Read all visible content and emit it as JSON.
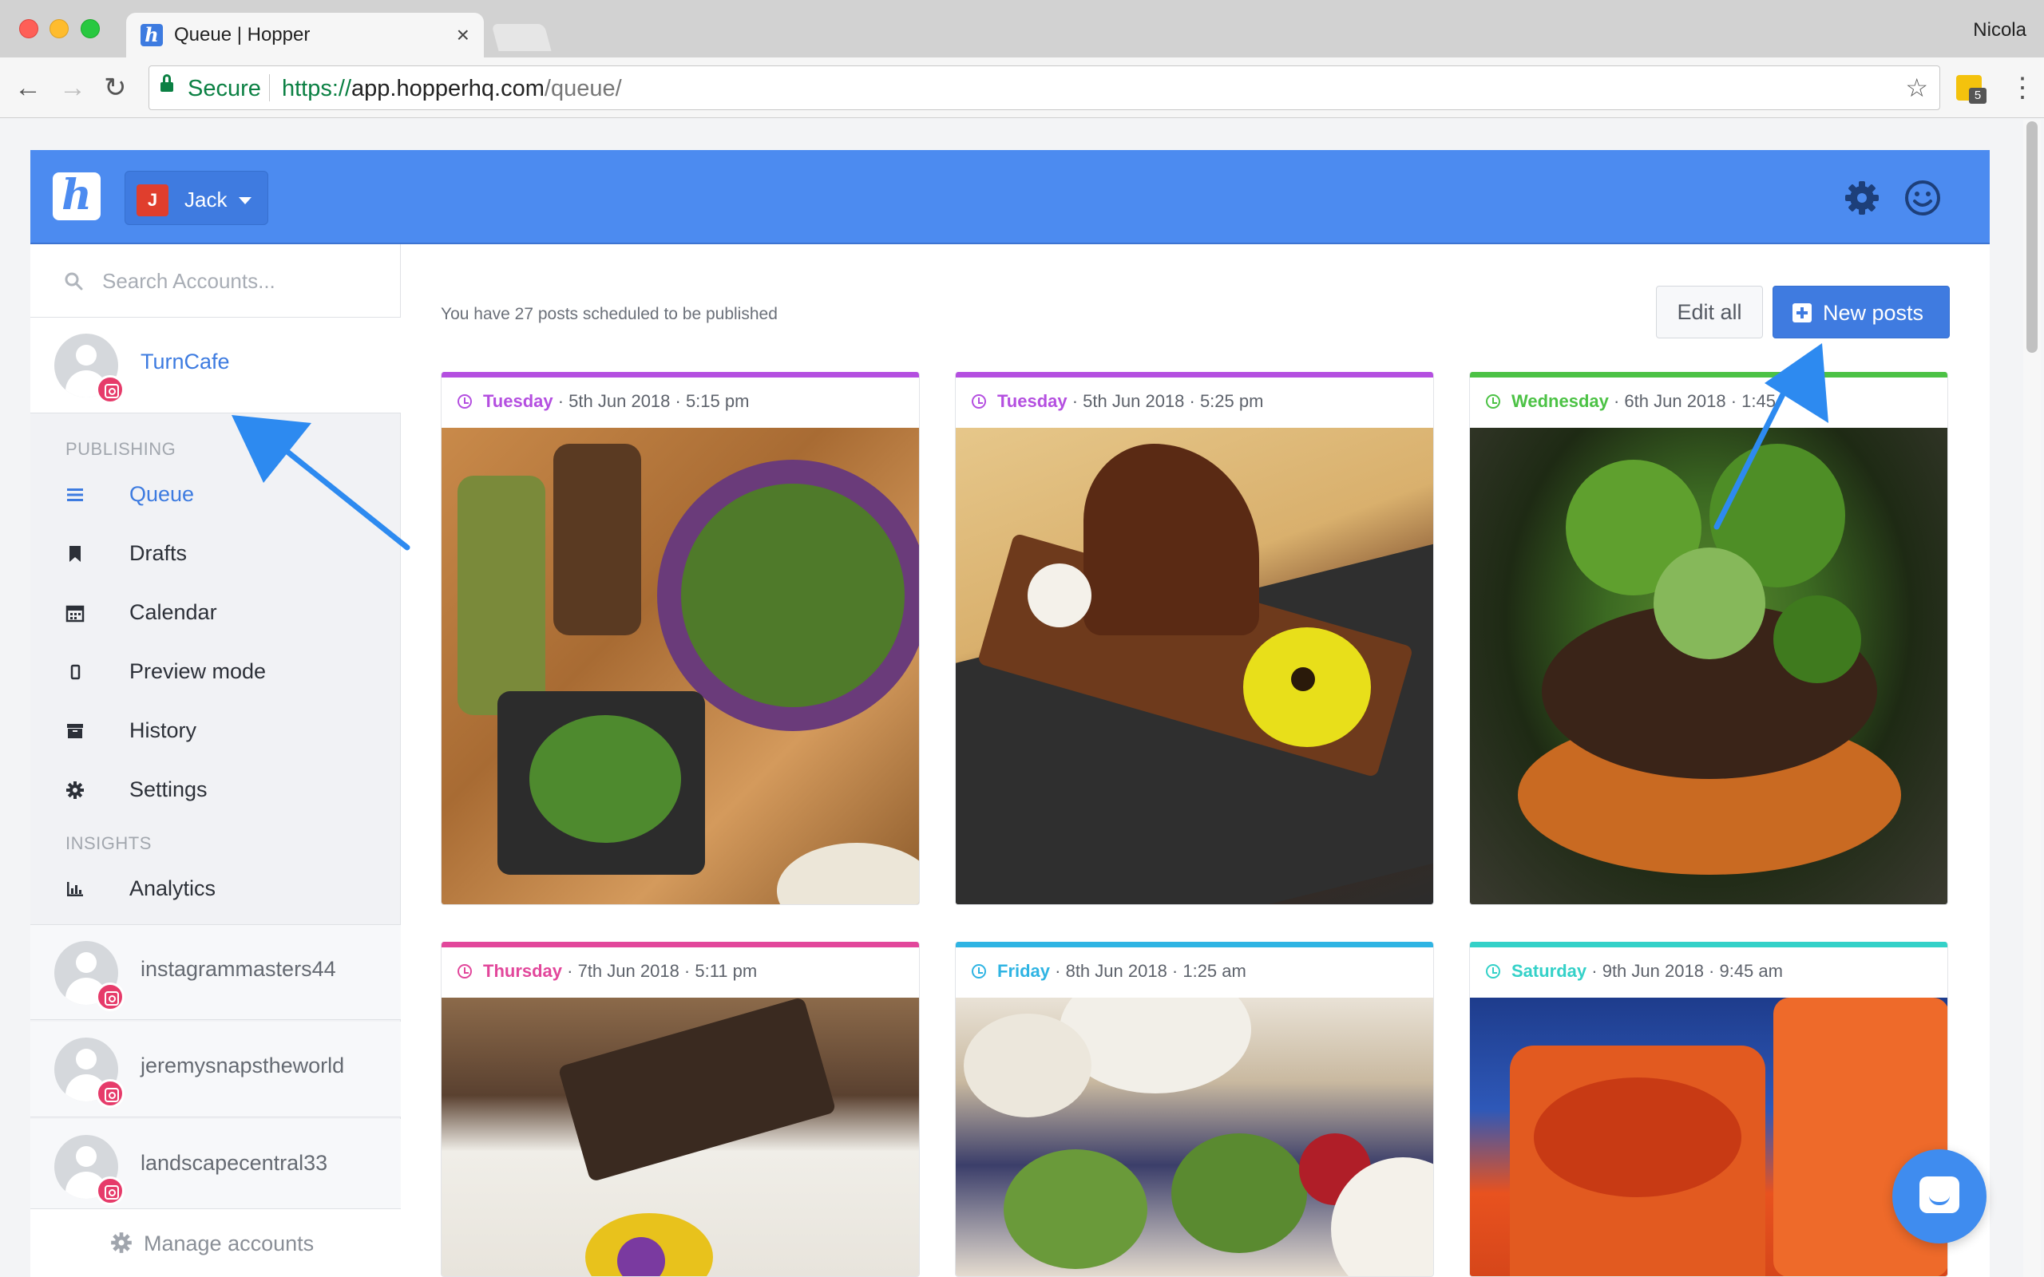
{
  "browser": {
    "tab_title": "Queue | Hopper",
    "profile_name": "Nicola",
    "secure_label": "Secure",
    "url_protocol": "https://",
    "url_host": "app.hopperhq.com",
    "url_path": "/queue/",
    "extension_badge": "5"
  },
  "header": {
    "logo_letter": "h",
    "account_initial": "J",
    "account_name": "Jack"
  },
  "sidebar": {
    "search_placeholder": "Search Accounts...",
    "active_account": "TurnCafe",
    "sections": {
      "publishing": "PUBLISHING",
      "insights": "INSIGHTS"
    },
    "items": [
      {
        "label": "Queue",
        "icon": "list-icon"
      },
      {
        "label": "Drafts",
        "icon": "bookmark-icon"
      },
      {
        "label": "Calendar",
        "icon": "calendar-icon"
      },
      {
        "label": "Preview mode",
        "icon": "phone-icon"
      },
      {
        "label": "History",
        "icon": "archive-icon"
      },
      {
        "label": "Settings",
        "icon": "gear-icon"
      }
    ],
    "analytics": {
      "label": "Analytics",
      "icon": "bar-chart-icon"
    },
    "other_accounts": [
      "instagrammasters44",
      "jeremysnapstheworld",
      "landscapecentral33"
    ],
    "manage_label": "Manage accounts"
  },
  "main": {
    "scheduled_text": "You have 27 posts scheduled to be published",
    "edit_all_label": "Edit all",
    "new_posts_label": "New posts"
  },
  "posts": [
    {
      "day": "Tuesday",
      "details": " · 5th Jun 2018 · 5:15 pm",
      "color": "#b44fe0"
    },
    {
      "day": "Tuesday",
      "details": " · 5th Jun 2018 · 5:25 pm",
      "color": "#b44fe0"
    },
    {
      "day": "Wednesday",
      "details": " · 6th Jun 2018 · 1:45",
      "color": "#4cc245"
    },
    {
      "day": "Thursday",
      "details": " · 7th Jun 2018 · 5:11 pm",
      "color": "#e2479b"
    },
    {
      "day": "Friday",
      "details": " · 8th Jun 2018 · 1:25 am",
      "color": "#2fb4e3"
    },
    {
      "day": "Saturday",
      "details": " · 9th Jun 2018 · 9:45 am",
      "color": "#34d1c8"
    }
  ],
  "colors": {
    "header_blue": "#4c8bf0",
    "link_blue": "#3d7be0",
    "instagram_pink": "#e63b6a",
    "annotation_arrow": "#2d8af0"
  }
}
